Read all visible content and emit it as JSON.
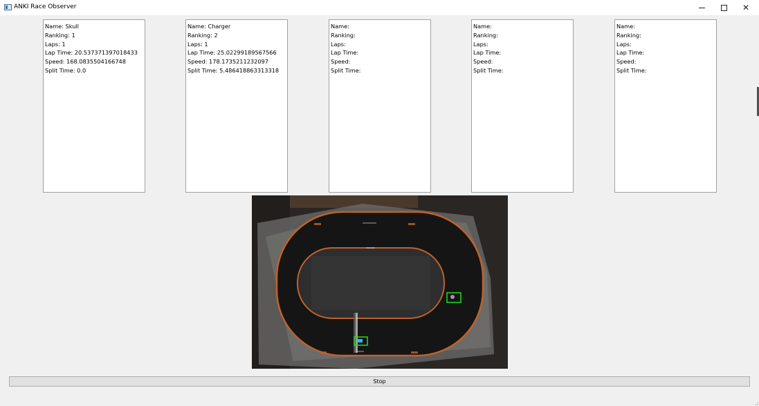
{
  "window": {
    "title": "ANKI Race Observer",
    "controls": {
      "minimize": "minimize-icon",
      "maximize": "maximize-icon",
      "close": "close-icon"
    }
  },
  "cars": [
    {
      "name_label": "Name: Skull",
      "ranking_label": "Ranking: 1",
      "laps_label": "Laps: 1",
      "lap_time_label": "Lap Time: 20.537371397018433",
      "speed_label": "Speed: 168.0835504166748",
      "split_time_label": "Split Time: 0.0"
    },
    {
      "name_label": "Name: Charger",
      "ranking_label": "Ranking: 2",
      "laps_label": "Laps: 1",
      "lap_time_label": "Lap Time: 25.02299189567566",
      "speed_label": "Speed: 178.1735211232097",
      "split_time_label": "Split Time: 5.486418863313318"
    },
    {
      "name_label": "Name:",
      "ranking_label": "Ranking:",
      "laps_label": "Laps:",
      "lap_time_label": "Lap Time:",
      "speed_label": "Speed:",
      "split_time_label": "Split Time:"
    },
    {
      "name_label": "Name:",
      "ranking_label": "Ranking:",
      "laps_label": "Laps:",
      "lap_time_label": "Lap Time:",
      "speed_label": "Speed:",
      "split_time_label": "Split Time:"
    },
    {
      "name_label": "Name:",
      "ranking_label": "Ranking:",
      "laps_label": "Laps:",
      "lap_time_label": "Lap Time:",
      "speed_label": "Speed:",
      "split_time_label": "Split Time:"
    }
  ],
  "camera": {
    "track_color": "#151515",
    "border_color": "#c0622a",
    "detection_color": "#22dd22"
  },
  "stop_button": {
    "label": "Stop"
  },
  "colors": {
    "window_bg": "#f0f0f0",
    "card_bg": "#ffffff",
    "button_bg": "#e1e1e1"
  }
}
